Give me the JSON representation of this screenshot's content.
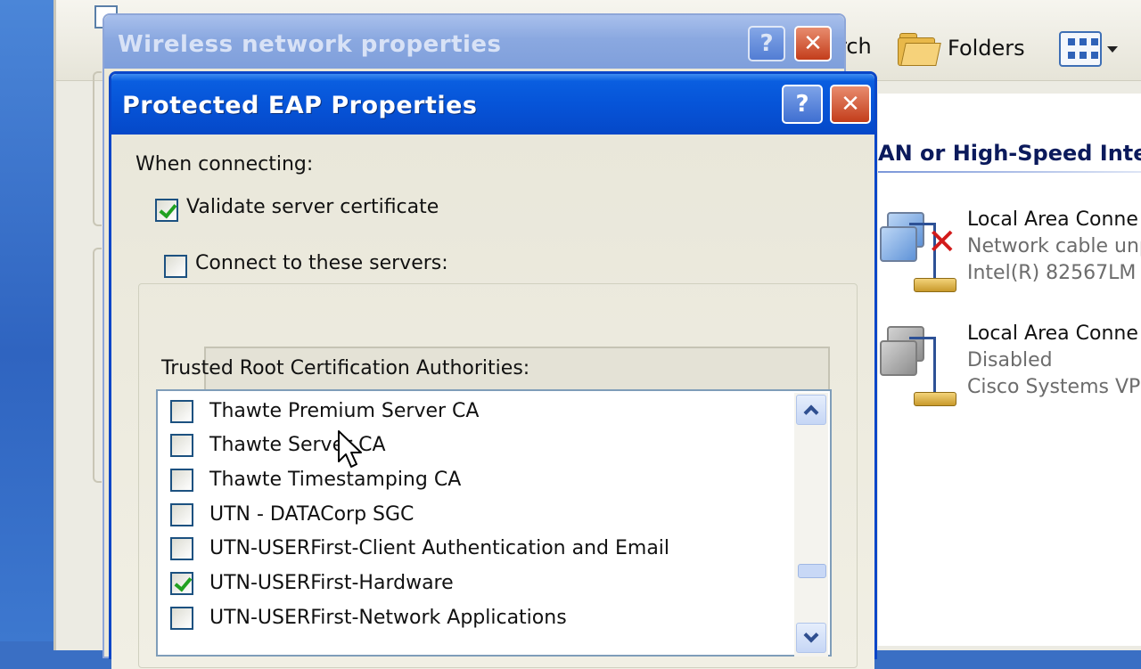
{
  "explorer": {
    "toolbar": {
      "search_tail": "rch",
      "folders_label": "Folders"
    },
    "section_heading": "AN or High-Speed Intern",
    "connections": [
      {
        "name": "Local Area Conne",
        "status": "Network cable unp",
        "device": "Intel(R) 82567LM"
      },
      {
        "name": "Local Area Conne",
        "status": "Disabled",
        "device": "Cisco Systems VPN"
      }
    ]
  },
  "wireless_window": {
    "title": "Wireless network properties",
    "help_glyph": "?",
    "close_glyph": "✕"
  },
  "peap_dialog": {
    "title": "Protected EAP Properties",
    "help_glyph": "?",
    "close_glyph": "✕",
    "when_connecting": "When connecting:",
    "validate_cert": {
      "label": "Validate server certificate",
      "checked": true
    },
    "connect_servers": {
      "label": "Connect to these servers:",
      "checked": false,
      "value": ""
    },
    "trusted_root_label": "Trusted Root Certification Authorities:",
    "ca_list": [
      {
        "label": "Thawte Premium Server CA",
        "checked": false
      },
      {
        "label": "Thawte Server CA",
        "checked": false
      },
      {
        "label": "Thawte Timestamping CA",
        "checked": false
      },
      {
        "label": "UTN - DATACorp SGC",
        "checked": false
      },
      {
        "label": "UTN-USERFirst-Client Authentication and Email",
        "checked": false
      },
      {
        "label": "UTN-USERFirst-Hardware",
        "checked": true
      },
      {
        "label": "UTN-USERFirst-Network Applications",
        "checked": false
      }
    ]
  }
}
